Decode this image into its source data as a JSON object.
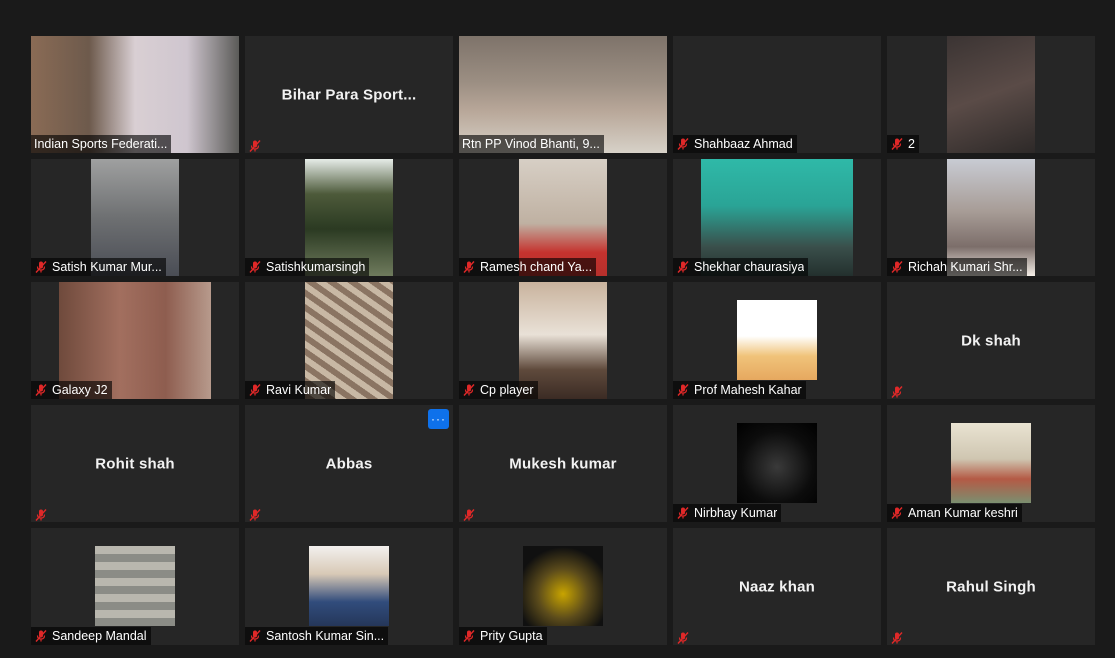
{
  "colors": {
    "background": "#1a1a1a",
    "tile": "#262626",
    "active_speaker_border": "#c9e27a",
    "mute_icon": "#e02828",
    "more_button": "#0e71eb"
  },
  "icons": {
    "mute": "microphone-muted-icon",
    "more": "more-options-icon"
  },
  "more_button_label": "···",
  "participants": [
    {
      "label": "Indian Sports Federati...",
      "center_name": "",
      "muted": false,
      "video": "full",
      "scene": "room"
    },
    {
      "label": "",
      "center_name": "Bihar Para Sport...",
      "muted": true,
      "video": "none",
      "scene": "none"
    },
    {
      "label": "Rtn PP Vinod Bhanti, 9...",
      "center_name": "",
      "muted": false,
      "video": "full",
      "scene": "elder",
      "active_speaker": true
    },
    {
      "label": "Shahbaaz Ahmad",
      "center_name": "",
      "muted": true,
      "video": "none",
      "scene": "none"
    },
    {
      "label": "2",
      "center_name": "",
      "muted": true,
      "video": "narrow",
      "scene": "dark"
    },
    {
      "label": "Satish Kumar Mur...",
      "center_name": "",
      "muted": true,
      "video": "narrow",
      "scene": "grey"
    },
    {
      "label": "Satishkumarsingh",
      "center_name": "",
      "muted": true,
      "video": "narrow",
      "scene": "tree"
    },
    {
      "label": "Ramesh chand Ya...",
      "center_name": "",
      "muted": true,
      "video": "narrow",
      "scene": "red"
    },
    {
      "label": "Shekhar  chaurasiya",
      "center_name": "",
      "muted": true,
      "video": "mid",
      "scene": "teal"
    },
    {
      "label": "Richah Kumari Shr...",
      "center_name": "",
      "muted": true,
      "video": "narrow",
      "scene": "woman"
    },
    {
      "label": "Galaxy J2",
      "center_name": "",
      "muted": true,
      "video": "mid",
      "scene": "brick"
    },
    {
      "label": "Ravi Kumar",
      "center_name": "",
      "muted": true,
      "video": "narrow",
      "scene": "roof"
    },
    {
      "label": "Cp player",
      "center_name": "",
      "muted": true,
      "video": "narrow",
      "scene": "wall"
    },
    {
      "label": "Prof Mahesh Kahar",
      "center_name": "",
      "muted": true,
      "video": "pic",
      "scene": "portrait"
    },
    {
      "label": "",
      "center_name": "Dk shah",
      "muted": true,
      "video": "none",
      "scene": "none"
    },
    {
      "label": "",
      "center_name": "Rohit shah",
      "muted": true,
      "video": "none",
      "scene": "none"
    },
    {
      "label": "",
      "center_name": "Abbas",
      "muted": true,
      "video": "none",
      "scene": "none",
      "more_button": true
    },
    {
      "label": "",
      "center_name": "Mukesh kumar",
      "muted": true,
      "video": "none",
      "scene": "none"
    },
    {
      "label": "Nirbhay Kumar",
      "center_name": "",
      "muted": true,
      "video": "pic",
      "scene": "suit"
    },
    {
      "label": "Aman Kumar keshri",
      "center_name": "",
      "muted": true,
      "video": "pic",
      "scene": "outdoor"
    },
    {
      "label": "Sandeep Mandal",
      "center_name": "",
      "muted": true,
      "video": "pic",
      "scene": "stone"
    },
    {
      "label": "Santosh Kumar Sin...",
      "center_name": "",
      "muted": true,
      "video": "pic",
      "scene": "blue"
    },
    {
      "label": "Prity Gupta",
      "center_name": "",
      "muted": true,
      "video": "pic",
      "scene": "night"
    },
    {
      "label": "",
      "center_name": "Naaz khan",
      "muted": true,
      "video": "none",
      "scene": "none"
    },
    {
      "label": "",
      "center_name": "Rahul Singh",
      "muted": true,
      "video": "none",
      "scene": "none"
    }
  ]
}
